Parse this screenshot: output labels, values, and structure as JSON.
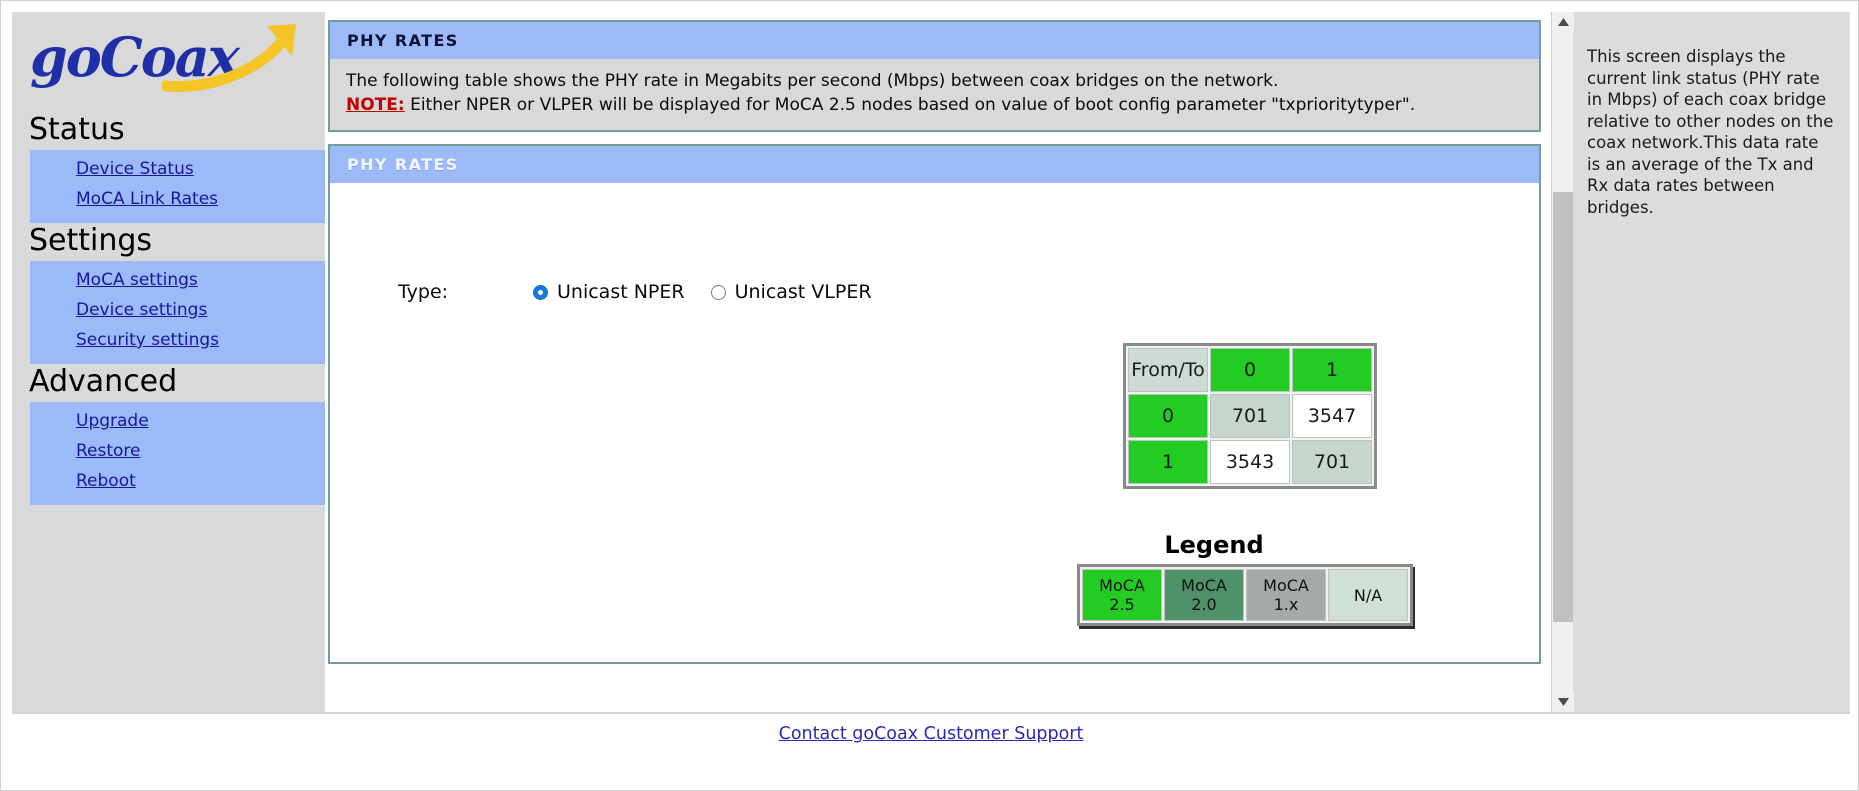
{
  "brand": {
    "logo_text": "goCoax",
    "logo_icon": "arrow-swoosh-icon"
  },
  "sidebar": {
    "sections": [
      {
        "title": "Status",
        "items": [
          {
            "label": "Device Status"
          },
          {
            "label": "MoCA Link Rates"
          }
        ]
      },
      {
        "title": "Settings",
        "items": [
          {
            "label": "MoCA settings"
          },
          {
            "label": "Device settings"
          },
          {
            "label": "Security settings"
          }
        ]
      },
      {
        "title": "Advanced",
        "items": [
          {
            "label": "Upgrade"
          },
          {
            "label": "Restore"
          },
          {
            "label": "Reboot"
          }
        ]
      }
    ]
  },
  "info_panel": {
    "header": "PHY RATES",
    "line1": "The following table shows the PHY rate in Megabits per second (Mbps) between coax bridges on the network.",
    "note_label": "NOTE:",
    "note_text": " Either NPER or VLPER will be displayed for MoCA 2.5 nodes based on value of boot config parameter \"txprioritytyper\"."
  },
  "rates_panel": {
    "header": "PHY RATES",
    "type_label": "Type:",
    "options": [
      {
        "label": "Unicast NPER",
        "selected": true
      },
      {
        "label": "Unicast VLPER",
        "selected": false
      }
    ]
  },
  "chart_data": {
    "type": "table",
    "title": "PHY RATES",
    "corner_label": "From/To",
    "columns": [
      "0",
      "1"
    ],
    "rows": [
      "0",
      "1"
    ],
    "values": [
      [
        701,
        3547
      ],
      [
        3543,
        701
      ]
    ],
    "units": "Mbps",
    "cell_kinds": [
      [
        "self",
        "rate"
      ],
      [
        "rate",
        "self"
      ]
    ],
    "node_color": "#22cc22",
    "header_color": "#cedbd4",
    "self_color": "#c6d6cd",
    "rate_color": "#ffffff"
  },
  "legend": {
    "title": "Legend",
    "items": [
      {
        "line1": "MoCA",
        "line2": "2.5",
        "color": "#22cc22"
      },
      {
        "line1": "MoCA",
        "line2": "2.0",
        "color": "#4f9168"
      },
      {
        "line1": "MoCA",
        "line2": "1.x",
        "color": "#a6aaa6"
      },
      {
        "line1": "N/A",
        "line2": "",
        "color": "#cfe0d6"
      }
    ]
  },
  "help": {
    "text": "This screen displays the current link status (PHY rate in Mbps) of each coax bridge relative to other nodes on the coax network.This data rate is an average of the Tx and Rx data rates between bridges."
  },
  "scrollbar": {
    "up_icon": "triangle-up-icon",
    "down_icon": "triangle-down-icon"
  },
  "footer": {
    "link_label": "Contact goCoax Customer Support"
  }
}
